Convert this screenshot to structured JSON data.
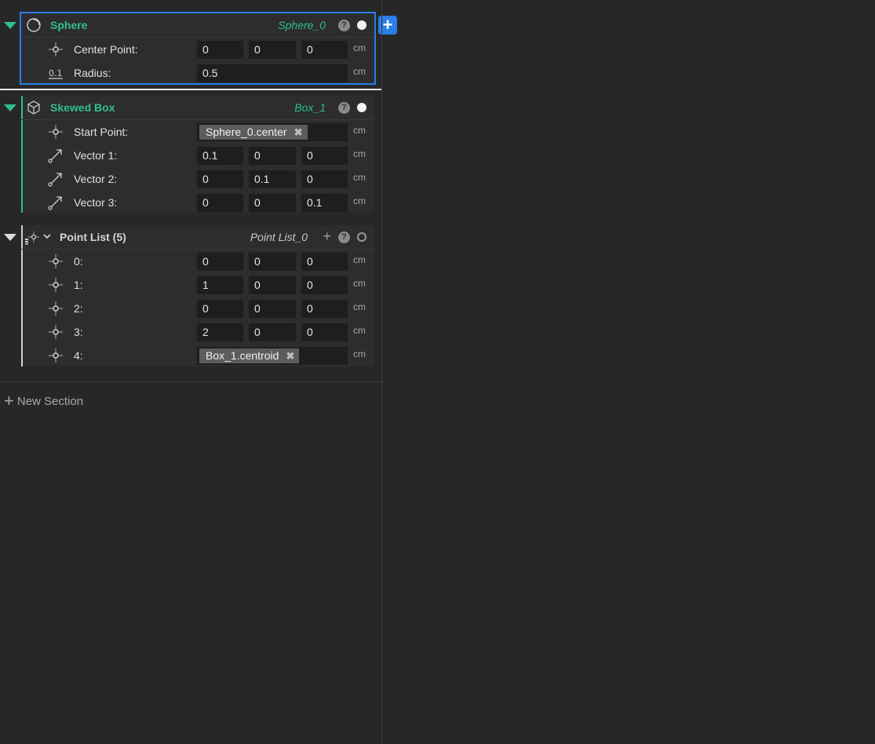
{
  "colors": {
    "accent": "#2fbf8f",
    "selection": "#2b7de9",
    "background": "#272727",
    "field": "#1e1e1e"
  },
  "sections": [
    {
      "title": "Sphere",
      "id": "Sphere_0",
      "icon": "sphere-icon",
      "rows": [
        {
          "label": "Center Point:",
          "icon": "point-icon",
          "values": [
            "0",
            "0",
            "0"
          ],
          "unit": "cm"
        },
        {
          "label": "Radius:",
          "icon": "scalar-icon",
          "values": [
            "0.5"
          ],
          "unit": "cm"
        }
      ]
    },
    {
      "title": "Skewed Box",
      "id": "Box_1",
      "icon": "box-icon",
      "rows": [
        {
          "label": "Start Point:",
          "icon": "point-icon",
          "ref": "Sphere_0.center",
          "unit": "cm"
        },
        {
          "label": "Vector 1:",
          "icon": "vector-icon",
          "values": [
            "0.1",
            "0",
            "0"
          ],
          "unit": "cm"
        },
        {
          "label": "Vector 2:",
          "icon": "vector-icon",
          "values": [
            "0",
            "0.1",
            "0"
          ],
          "unit": "cm"
        },
        {
          "label": "Vector 3:",
          "icon": "vector-icon",
          "values": [
            "0",
            "0",
            "0.1"
          ],
          "unit": "cm"
        }
      ]
    },
    {
      "title": "Point List (5)",
      "id": "Point List_0",
      "icon": "point-list-icon",
      "rows": [
        {
          "label": "0:",
          "icon": "point-icon",
          "values": [
            "0",
            "0",
            "0"
          ],
          "unit": "cm"
        },
        {
          "label": "1:",
          "icon": "point-icon",
          "values": [
            "1",
            "0",
            "0"
          ],
          "unit": "cm"
        },
        {
          "label": "2:",
          "icon": "point-icon",
          "values": [
            "0",
            "0",
            "0"
          ],
          "unit": "cm"
        },
        {
          "label": "3:",
          "icon": "point-icon",
          "values": [
            "2",
            "0",
            "0"
          ],
          "unit": "cm"
        },
        {
          "label": "4:",
          "icon": "point-icon",
          "ref": "Box_1.centroid",
          "unit": "cm"
        }
      ]
    }
  ],
  "help_glyph": "?",
  "remove_glyph": "✖",
  "add_glyph": "+",
  "new_section": {
    "plus": "+",
    "label": "New Section"
  }
}
